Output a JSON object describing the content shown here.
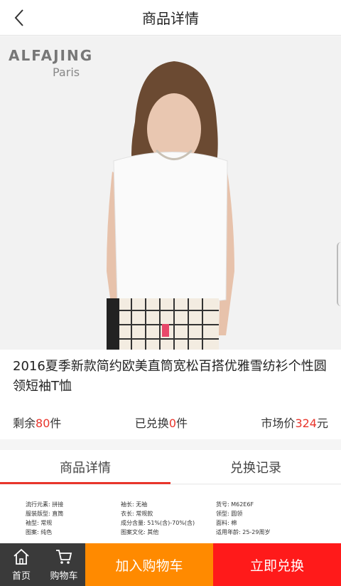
{
  "header": {
    "title": "商品详情",
    "back_icon": "chevron-left-icon"
  },
  "brand": {
    "name": "ALFAJING",
    "subtitle": "Paris"
  },
  "product": {
    "title": "2016夏季新款简约欧美直筒宽松百搭优雅雪纺衫个性圆领短袖T恤",
    "remaining_prefix": "剩余",
    "remaining_value": "80",
    "remaining_suffix": "件",
    "redeemed_prefix": "已兑换",
    "redeemed_value": "0",
    "redeemed_suffix": "件",
    "market_prefix": "市场价",
    "market_value": "324",
    "market_suffix": "元"
  },
  "tabs": [
    {
      "label": "商品详情"
    },
    {
      "label": "兑换记录"
    }
  ],
  "specs": [
    "流行元素: 拼接",
    "袖长: 无袖",
    "货号: M62E6F",
    "服装版型: 直筒",
    "衣长: 常规款",
    "领型: 圆领",
    "袖型: 常规",
    "成分含量: 51%(含)-70%(含)",
    "面料: 棉",
    "图案: 纯色",
    "图案文化: 其他",
    "适用年龄: 25-29周岁"
  ],
  "bottom": {
    "home_label": "首页",
    "cart_label": "购物车",
    "add_to_cart": "加入购物车",
    "redeem_now": "立即兑换"
  },
  "colors": {
    "accent_red": "#e8352b",
    "cart_orange": "#ff8a00",
    "redeem_red": "#ff1a1a",
    "nav_dark": "#3a3a3a"
  }
}
